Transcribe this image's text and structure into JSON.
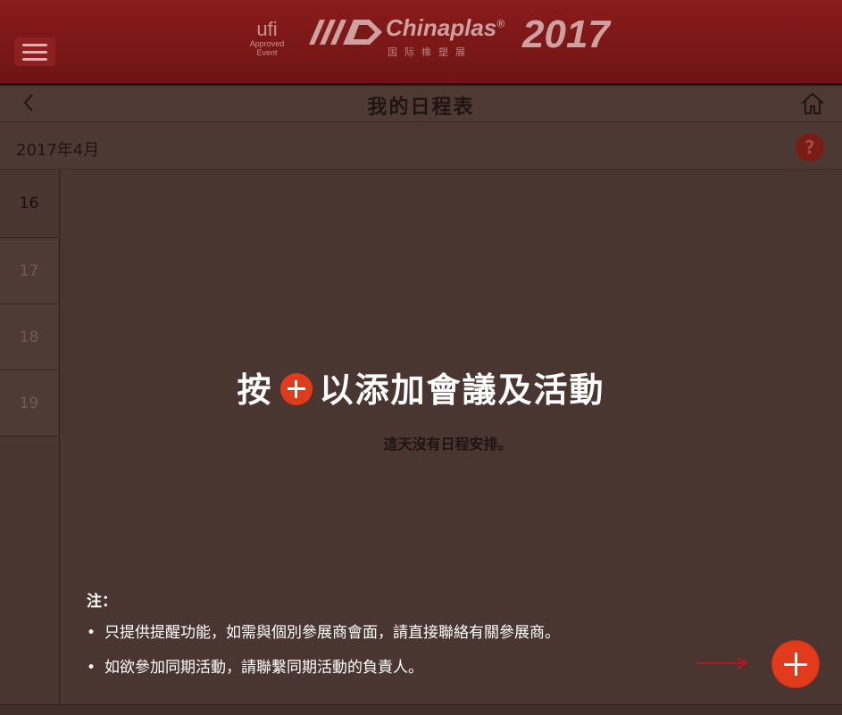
{
  "header": {
    "ufi_mark": "ufi",
    "ufi_caption": "Approved Event",
    "logo_text": "Chinaplas",
    "logo_reg": "®",
    "logo_subtitle": "国际橡塑展",
    "logo_year": "2017",
    "menu_icon": "hamburger-icon"
  },
  "titlebar": {
    "title": "我的日程表",
    "back_icon": "chevron-left-icon",
    "home_icon": "home-icon"
  },
  "calendar": {
    "month": "2017年4月",
    "help_label": "?",
    "days": [
      {
        "label": "16",
        "active": true
      },
      {
        "label": "17",
        "active": false
      },
      {
        "label": "18",
        "active": false
      },
      {
        "label": "19",
        "active": false
      }
    ]
  },
  "main": {
    "hint_prefix": "按",
    "hint_suffix": "以添加會議及活動",
    "empty_message": "這天沒有日程安排。"
  },
  "notes": {
    "title": "注：",
    "items": [
      "只提供提醒功能，如需與個別參展商會面，請直接聯絡有關參展商。",
      "如欲參加同期活動，請聯繫同期活動的負責人。"
    ]
  },
  "colors": {
    "banner": "#7a1818",
    "background": "#4a3630",
    "accent": "#e23b1b"
  },
  "add_button_icon": "plus-icon"
}
